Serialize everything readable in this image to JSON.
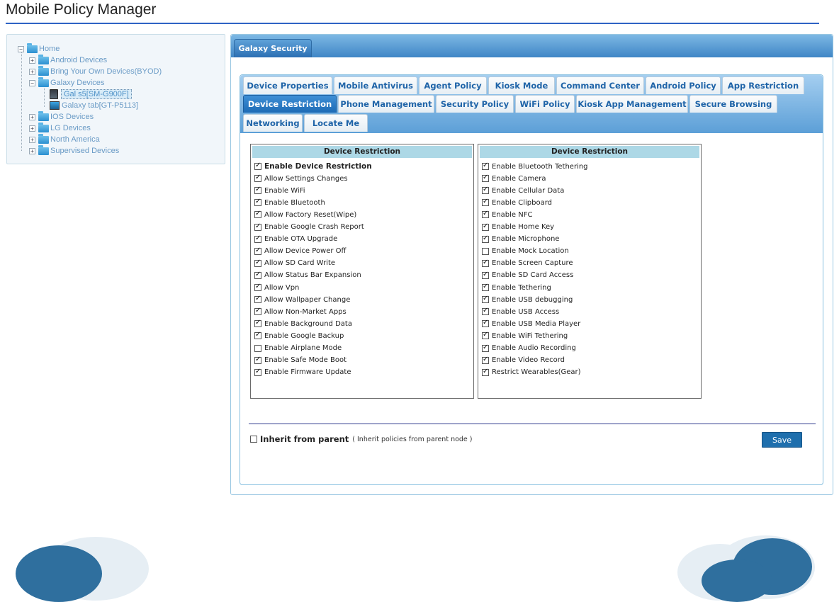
{
  "app": {
    "title": "Mobile Policy Manager"
  },
  "tree": {
    "root": "Home",
    "groups": [
      "Android Devices",
      "Bring Your Own Devices(BYOD)",
      "Galaxy Devices"
    ],
    "galaxy_devices": [
      "Gal s5[SM-G900F]",
      "Galaxy tab[GT-P5113]"
    ],
    "other_groups": [
      "IOS Devices",
      "LG Devices",
      "North America",
      "Supervised Devices"
    ],
    "toggles": {
      "expanded": "−",
      "collapsed": "+"
    }
  },
  "main": {
    "outer_tab": "Galaxy Security",
    "tabs_row1": [
      "Device Properties",
      "Mobile Antivirus",
      "Agent Policy",
      "Kiosk Mode",
      "Command Center",
      "Android Policy",
      "App Restriction"
    ],
    "tabs_row2": [
      "Device Restriction",
      "Phone Management",
      "Security Policy",
      "WiFi Policy",
      "Kiosk App Management",
      "Secure Browsing"
    ],
    "tabs_row3": [
      "Networking",
      "Locate Me"
    ],
    "active_tab": "Device Restriction"
  },
  "restrictions": {
    "left": {
      "header": "Device Restriction",
      "items": [
        {
          "label": "Enable Device Restriction",
          "checked": true
        },
        {
          "label": "Allow Settings Changes",
          "checked": true
        },
        {
          "label": "Enable WiFi",
          "checked": true
        },
        {
          "label": "Enable Bluetooth",
          "checked": true
        },
        {
          "label": "Allow Factory Reset(Wipe)",
          "checked": true
        },
        {
          "label": "Enable Google Crash Report",
          "checked": true
        },
        {
          "label": "Enable OTA Upgrade",
          "checked": true
        },
        {
          "label": "Allow Device Power Off",
          "checked": true
        },
        {
          "label": "Allow SD Card Write",
          "checked": true
        },
        {
          "label": "Allow Status Bar Expansion",
          "checked": true
        },
        {
          "label": "Allow Vpn",
          "checked": true
        },
        {
          "label": "Allow Wallpaper Change",
          "checked": true
        },
        {
          "label": "Allow Non-Market Apps",
          "checked": true
        },
        {
          "label": "Enable Background Data",
          "checked": true
        },
        {
          "label": "Enable Google Backup",
          "checked": true
        },
        {
          "label": "Enable Airplane Mode",
          "checked": false
        },
        {
          "label": "Enable Safe Mode Boot",
          "checked": true
        },
        {
          "label": "Enable Firmware Update",
          "checked": true
        }
      ]
    },
    "right": {
      "header": "Device Restriction",
      "items": [
        {
          "label": "Enable Bluetooth Tethering",
          "checked": true
        },
        {
          "label": "Enable Camera",
          "checked": true
        },
        {
          "label": "Enable Cellular Data",
          "checked": true
        },
        {
          "label": "Enable Clipboard",
          "checked": true
        },
        {
          "label": "Enable NFC",
          "checked": true
        },
        {
          "label": "Enable Home Key",
          "checked": true
        },
        {
          "label": "Enable Microphone",
          "checked": true
        },
        {
          "label": "Enable Mock Location",
          "checked": false
        },
        {
          "label": "Enable Screen Capture",
          "checked": true
        },
        {
          "label": "Enable SD Card Access",
          "checked": true
        },
        {
          "label": "Enable Tethering",
          "checked": true
        },
        {
          "label": "Enable USB debugging",
          "checked": true
        },
        {
          "label": "Enable USB Access",
          "checked": true
        },
        {
          "label": "Enable USB Media Player",
          "checked": true
        },
        {
          "label": "Enable WiFi Tethering",
          "checked": true
        },
        {
          "label": "Enable Audio Recording",
          "checked": true
        },
        {
          "label": "Enable Video Record",
          "checked": true
        },
        {
          "label": "Restrict Wearables(Gear)",
          "checked": true
        }
      ]
    }
  },
  "footer": {
    "inherit_label": "Inherit from parent",
    "inherit_note": "( Inherit policies from parent node )",
    "inherit_checked": false,
    "save_label": "Save"
  },
  "colors": {
    "accent": "#2f63c4",
    "tab_active": "#1e6bb5",
    "tab_text": "#1f64a8",
    "header_bg": "#add8e6",
    "save_button": "#1f6fad"
  },
  "icons": [
    "folder-icon",
    "expand-toggle-icon",
    "phone-device-icon",
    "tablet-device-icon",
    "checkbox-icon"
  ]
}
